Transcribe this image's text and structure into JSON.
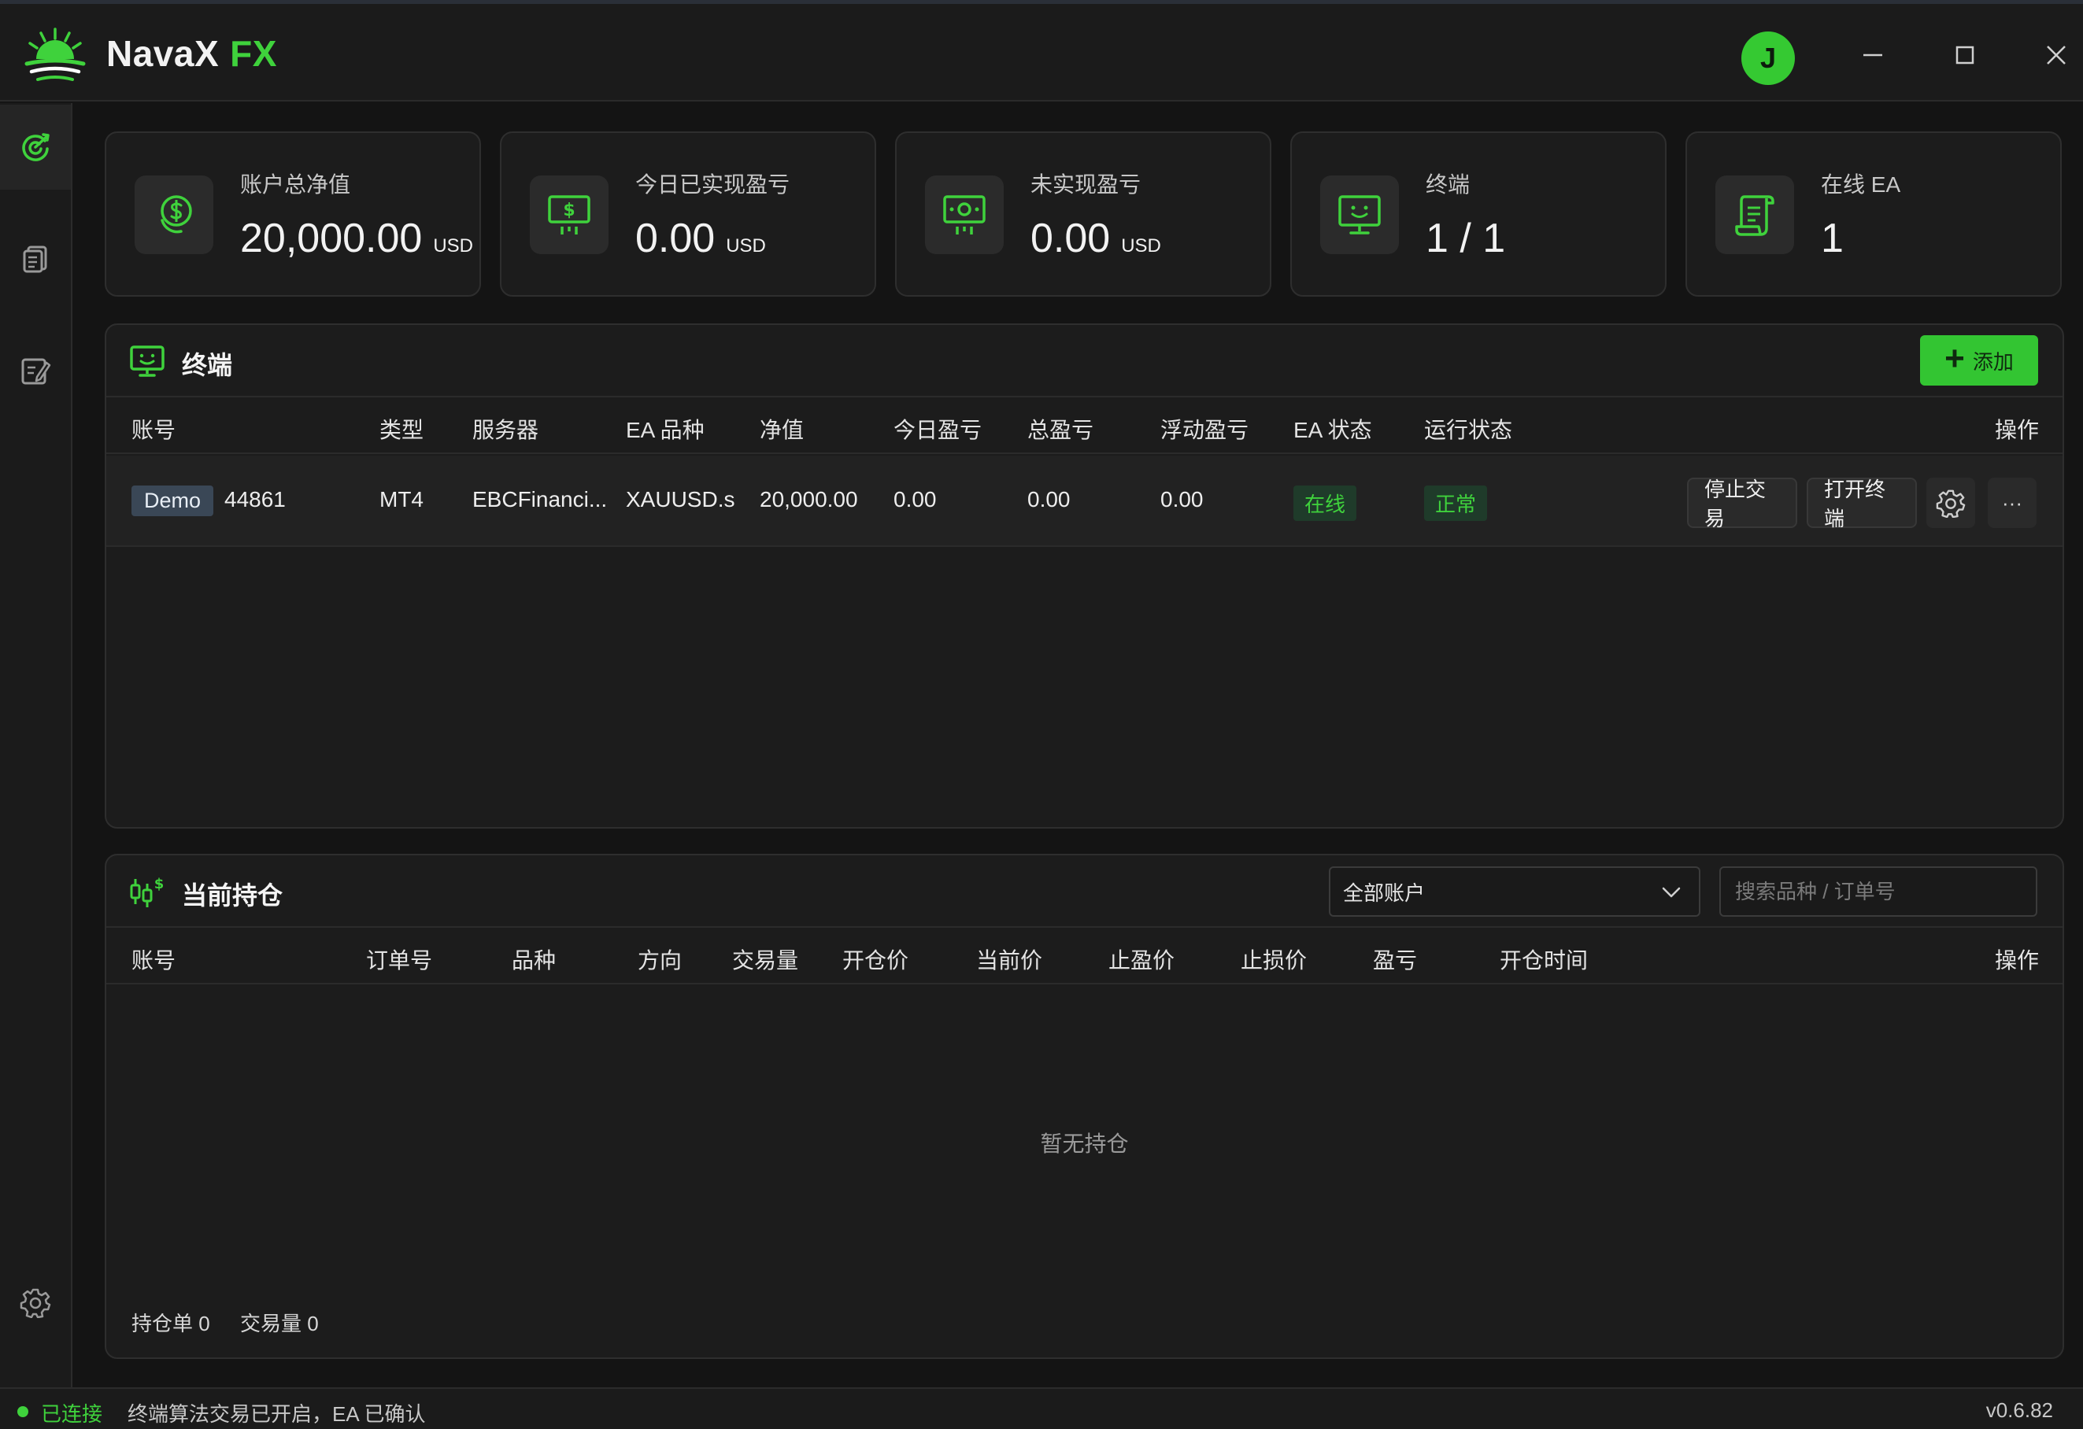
{
  "app": {
    "name_part1": "NavaX",
    "name_part2": "FX",
    "user_initial": "J"
  },
  "colors": {
    "accent": "#3fd23c",
    "background": "#141414",
    "panel": "#1c1c1c",
    "tag_demo": "#3a4756"
  },
  "sidebar": {
    "items": [
      {
        "icon": "dashboard-icon",
        "active": true
      },
      {
        "icon": "document-list-icon",
        "active": false
      },
      {
        "icon": "edit-note-icon",
        "active": false
      },
      {
        "icon": "gear-icon",
        "active": false
      }
    ]
  },
  "stats": [
    {
      "label": "账户总净值",
      "value": "20,000.00",
      "unit": "USD",
      "icon": "dollar-circle-icon"
    },
    {
      "label": "今日已实现盈亏",
      "value": "0.00",
      "unit": "USD",
      "icon": "money-screen-icon"
    },
    {
      "label": "未实现盈亏",
      "value": "0.00",
      "unit": "USD",
      "icon": "money-coin-icon"
    },
    {
      "label": "终端",
      "value": "1 / 1",
      "unit": "",
      "icon": "monitor-face-icon"
    },
    {
      "label": "在线 EA",
      "value": "1",
      "unit": "",
      "icon": "script-icon"
    }
  ],
  "terminals": {
    "title": "终端",
    "add_label": "添加",
    "columns": [
      "账号",
      "类型",
      "服务器",
      "EA 品种",
      "净值",
      "今日盈亏",
      "总盈亏",
      "浮动盈亏",
      "EA 状态",
      "运行状态",
      "操作"
    ],
    "rows": [
      {
        "tag": "Demo",
        "account": "44861",
        "type": "MT4",
        "server": "EBCFinanci...",
        "symbol": "XAUUSD.s",
        "equity": "20,000.00",
        "today_pl": "0.00",
        "total_pl": "0.00",
        "float_pl": "0.00",
        "ea_status": "在线",
        "run_status": "正常",
        "stop_label": "停止交易",
        "open_label": "打开终端",
        "more_label": "···"
      }
    ]
  },
  "positions": {
    "title": "当前持仓",
    "account_filter": "全部账户",
    "search_placeholder": "搜索品种 / 订单号",
    "columns": [
      "账号",
      "订单号",
      "品种",
      "方向",
      "交易量",
      "开仓价",
      "当前价",
      "止盈价",
      "止损价",
      "盈亏",
      "开仓时间",
      "操作"
    ],
    "empty_text": "暂无持仓",
    "count_label": "持仓单 0",
    "volume_label": "交易量 0"
  },
  "status": {
    "connected": "已连接",
    "message": "终端算法交易已开启，EA 已确认",
    "version": "v0.6.82"
  }
}
